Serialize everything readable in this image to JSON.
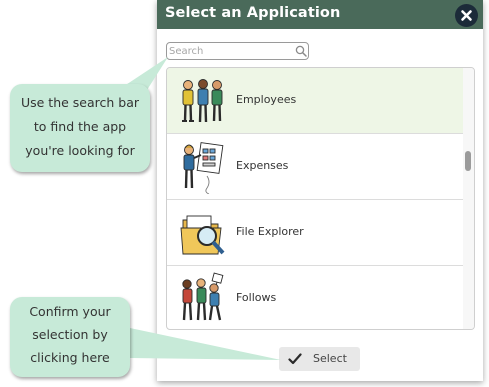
{
  "dialog": {
    "title": "Select an Application",
    "close_icon": "close-x-icon",
    "header_color": "#4a6a5a",
    "close_color": "#1c2b39"
  },
  "search": {
    "placeholder": "Search",
    "value": "",
    "icon": "magnifier-icon"
  },
  "apps": [
    {
      "label": "Employees",
      "icon": "employees-illustration",
      "selected": true
    },
    {
      "label": "Expenses",
      "icon": "expenses-illustration",
      "selected": false
    },
    {
      "label": "File Explorer",
      "icon": "file-explorer-illustration",
      "selected": false
    },
    {
      "label": "Follows",
      "icon": "follows-illustration",
      "selected": false
    }
  ],
  "select_button": {
    "label": "Select",
    "icon": "checkmark-icon"
  },
  "callouts": {
    "search_tip": [
      "Use the search bar",
      "to find the app",
      "you're looking for"
    ],
    "select_tip": [
      "Confirm your",
      "selection by",
      "clicking here"
    ],
    "color": "#c7ead8"
  },
  "colors": {
    "selected_row": "#eef6e6"
  }
}
